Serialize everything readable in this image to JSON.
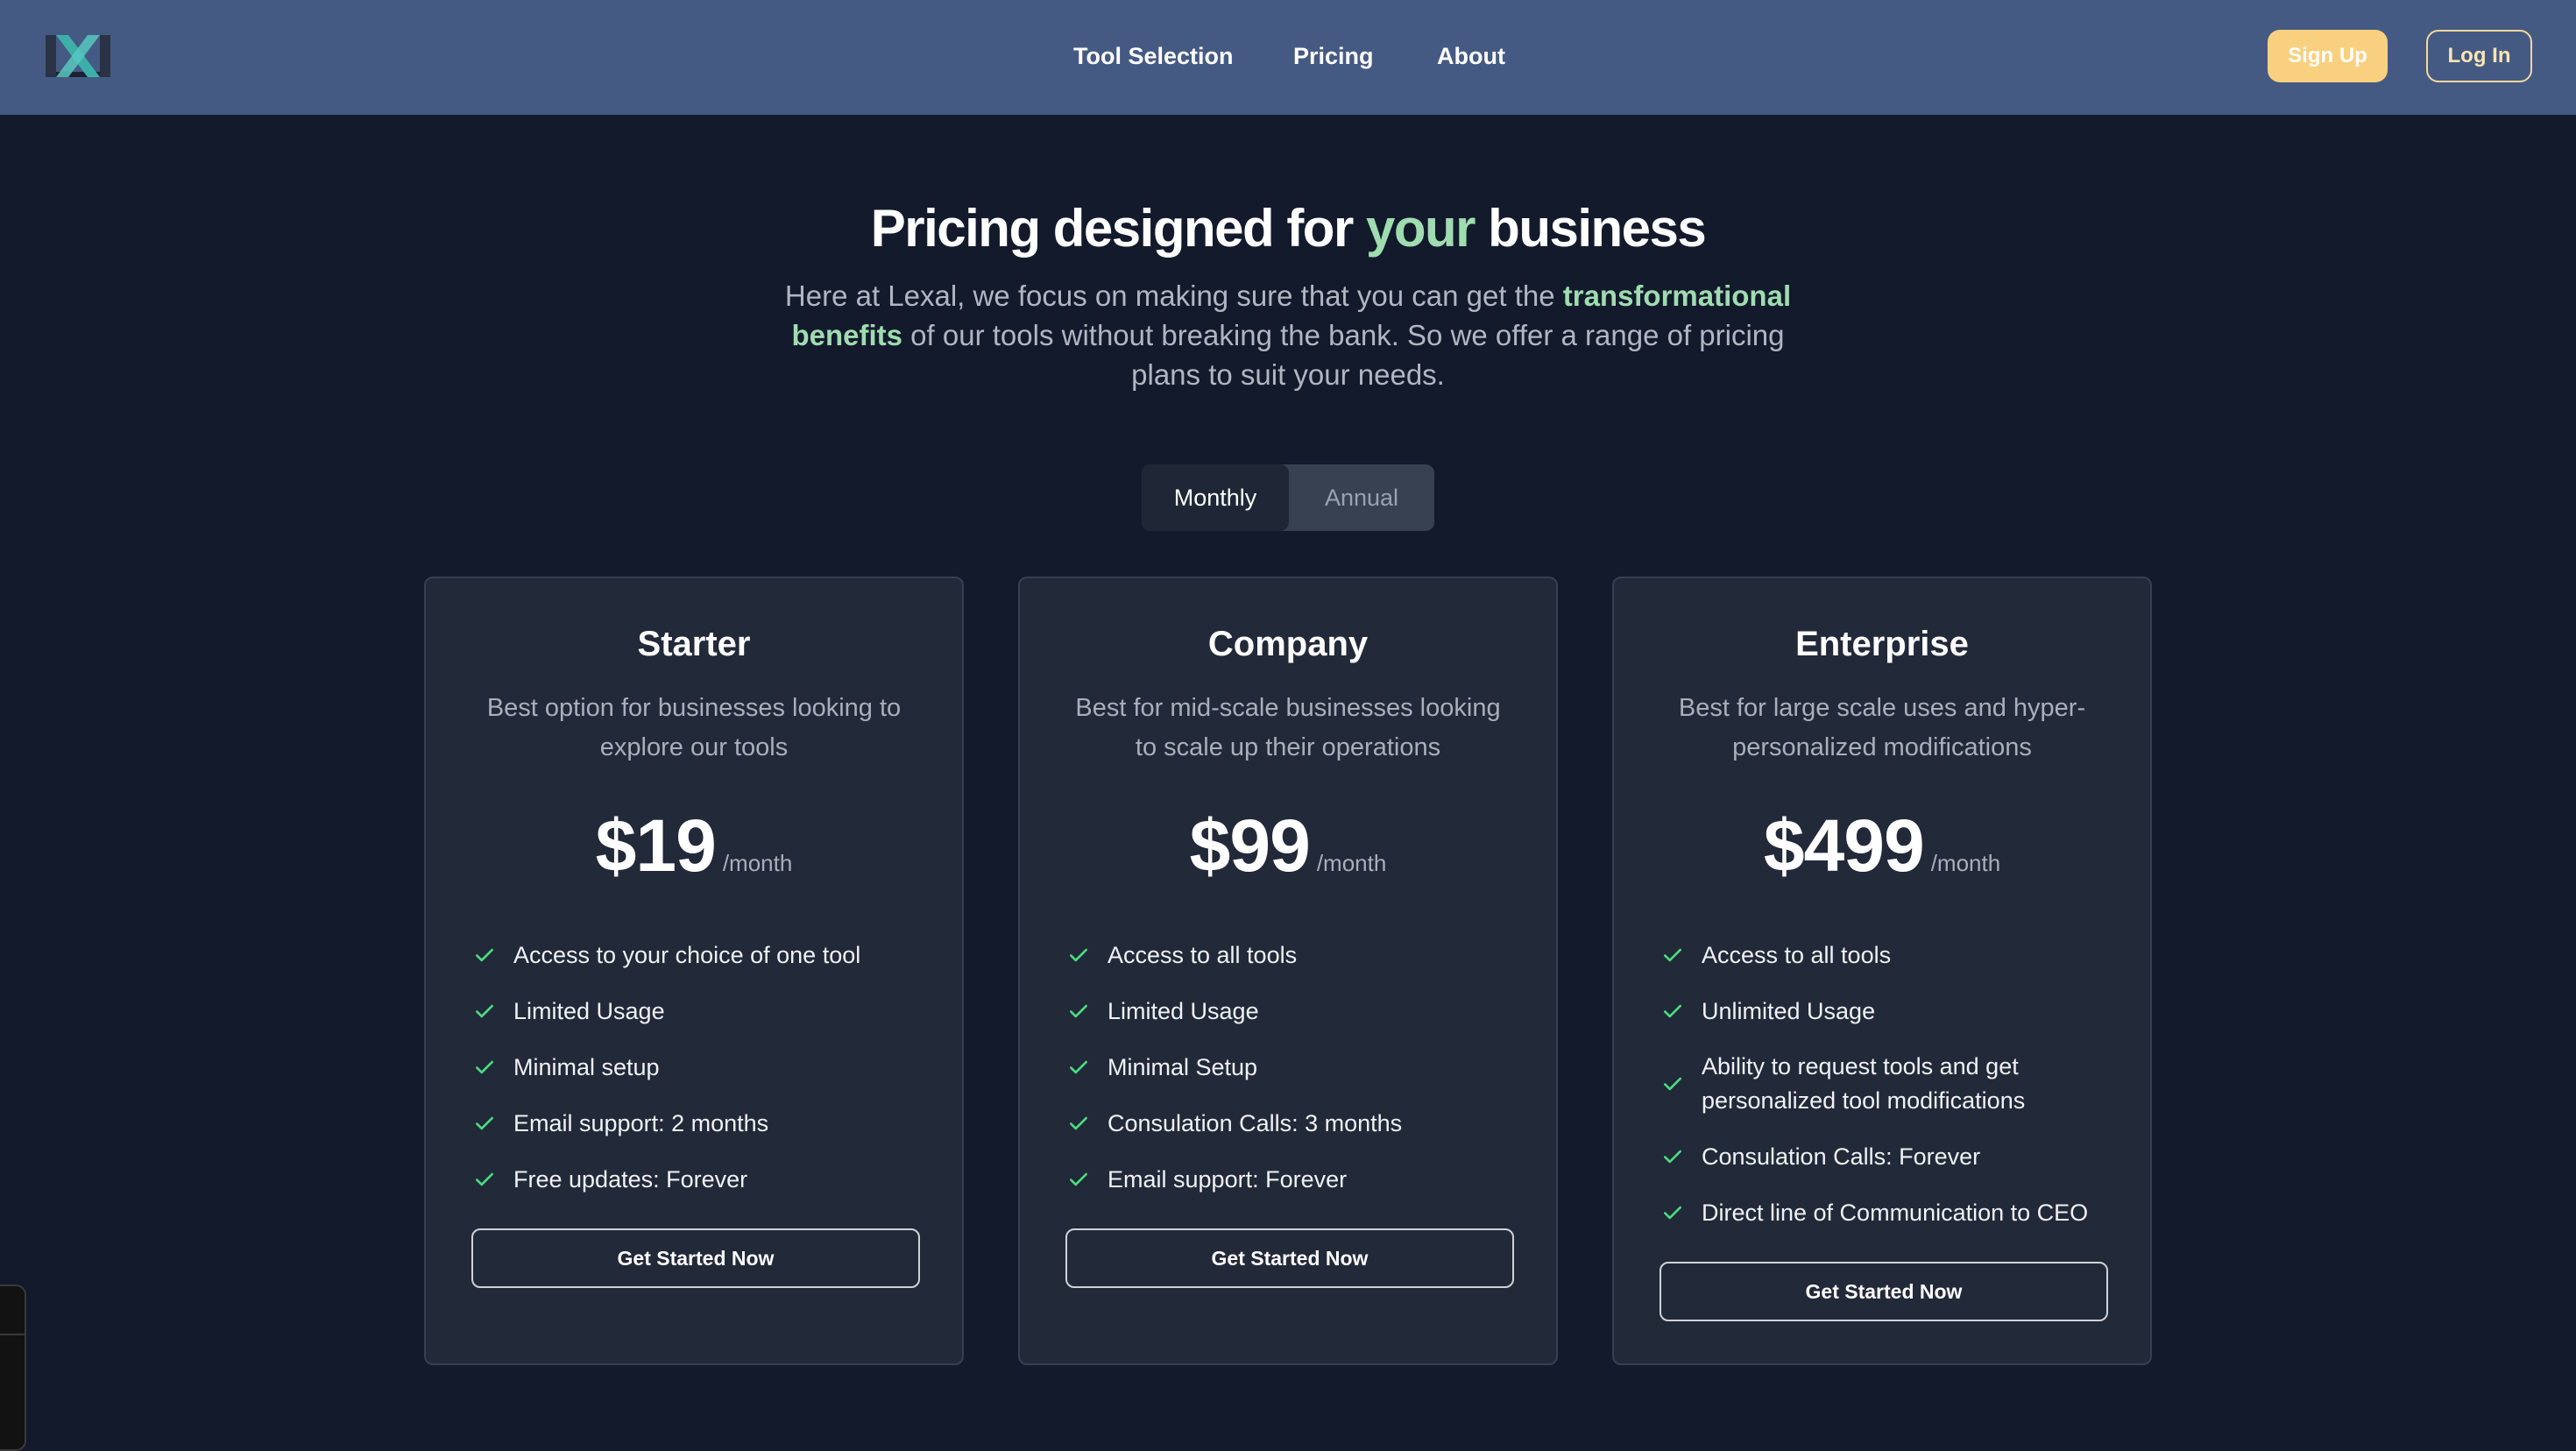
{
  "nav": {
    "links": [
      "Tool Selection",
      "Pricing",
      "About"
    ],
    "signup_label": "Sign Up",
    "login_label": "Log In"
  },
  "hero": {
    "title_pre": "Pricing designed for ",
    "title_accent": "your",
    "title_post": " business",
    "sub_pre": "Here at Lexal, we focus on making sure that you can get the ",
    "sub_bold": "transformational benefits",
    "sub_post": " of our tools without breaking the bank. So we offer a range of pricing plans to suit your needs."
  },
  "billing_toggle": {
    "options": [
      "Monthly",
      "Annual"
    ],
    "selected": "Monthly"
  },
  "plans": [
    {
      "name": "Starter",
      "description": "Best option for businesses looking to explore our tools",
      "price": "$19",
      "period": "/month",
      "features": [
        "Access to your choice of one tool",
        "Limited Usage",
        "Minimal setup",
        "Email support: 2 months",
        "Free updates: Forever"
      ],
      "cta": "Get Started Now"
    },
    {
      "name": "Company",
      "description": "Best for mid-scale businesses looking to scale up their operations",
      "price": "$99",
      "period": "/month",
      "features": [
        "Access to all tools",
        "Limited Usage",
        "Minimal Setup",
        "Consulation Calls: 3 months",
        "Email support: Forever"
      ],
      "cta": "Get Started Now"
    },
    {
      "name": "Enterprise",
      "description": "Best for large scale uses and hyper-personalized modifications",
      "price": "$499",
      "period": "/month",
      "features": [
        "Access to all tools",
        "Unlimited Usage",
        "Ability to request tools and get personalized tool modifications",
        "Consulation Calls: Forever",
        "Direct line of Communication to CEO"
      ],
      "cta": "Get Started Now"
    }
  ],
  "colors": {
    "nav_bg": "#455a83",
    "page_bg": "#131a2c",
    "card_bg": "#222939",
    "accent_green": "#9fdcb0",
    "check_green": "#4ade80",
    "signup_yellow": "#f9d07f"
  },
  "icons": {
    "logo": "lexal-logo-icon",
    "feature": "check-icon"
  }
}
